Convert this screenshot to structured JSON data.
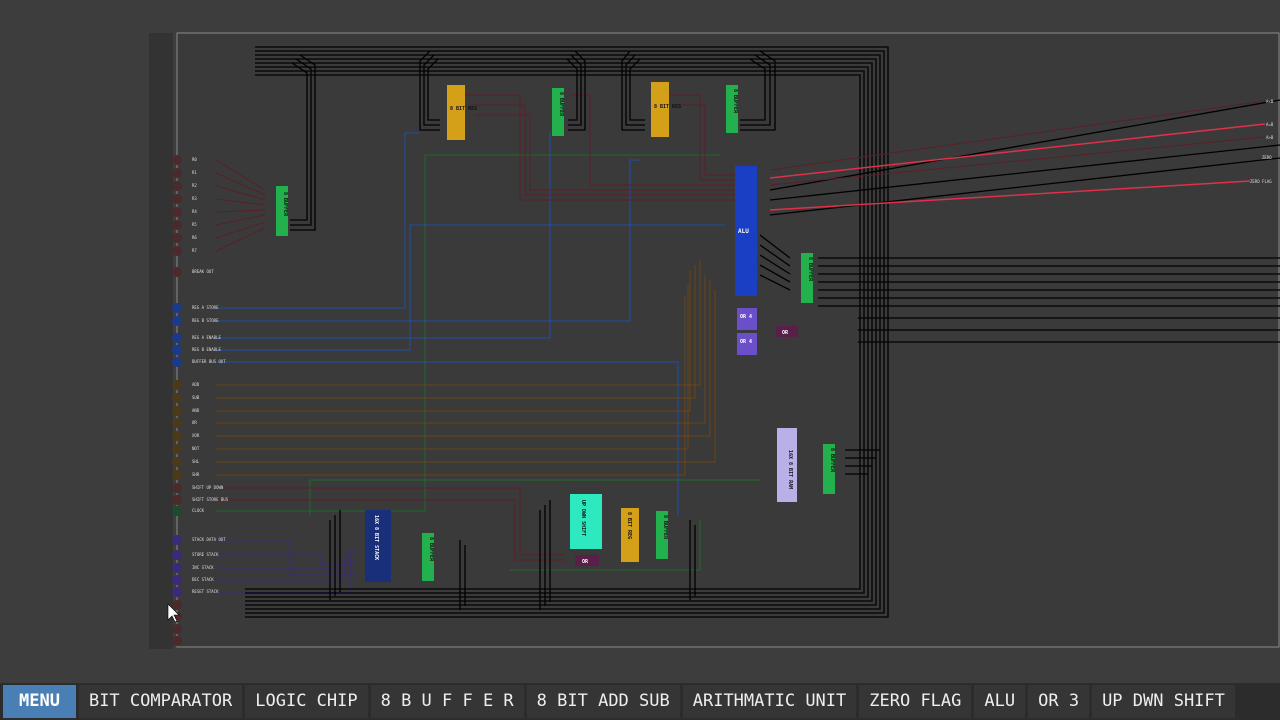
{
  "menu": {
    "label": "MENU"
  },
  "toolbar": {
    "items": [
      "BIT COMPARATOR",
      "LOGIC CHIP",
      "8 B U F F E R",
      "8 BIT ADD SUB",
      "ARITHMATIC UNIT",
      "ZERO FLAG",
      "ALU",
      "OR 3",
      "UP DWN SHIFT"
    ]
  },
  "colors": {
    "background": "#3d3d3d",
    "board": "#3a3a3a",
    "wire": "#000000",
    "register_chip": "#d4a017",
    "buffer_chip": "#22b14c",
    "alu_chip": "#1a3fc4",
    "or_chip": "#6b4fc9",
    "stack_chip": "#1a2f7a",
    "shift_chip": "#2ee8c0",
    "ram_chip": "#b9b0e8",
    "menu_accent": "#4a7fb5"
  },
  "chips": {
    "reg_a": "8 BIT REG",
    "buf_a": "8 BUFFER",
    "reg_b": "8 BIT REG",
    "buf_b": "8 BUFFER",
    "buf_in": "8 BUFFER",
    "alu": "ALU",
    "buf_alu": "8 BUFFER",
    "or4_a": "OR 4",
    "or4_b": "OR 4",
    "or_flag": "OR",
    "ram": "16X 8 BIT RAM",
    "buf_ram": "8 BUFFER",
    "stack": "16X 8 BIT STACK",
    "buf_stack": "8 BUFFER",
    "shift": "UP DWN SHIFT",
    "reg_c": "8 BIT REG",
    "buf_c": "8 BUFFER",
    "or_shift": "OR"
  },
  "pins": {
    "alu_outputs": [
      "A<B",
      "A=B",
      "A>B",
      "ZERO",
      "ZERO FLAG"
    ],
    "input_group_a": [
      "R0",
      "R1",
      "R2",
      "R3",
      "R4",
      "R5",
      "R6",
      "R7",
      "BREAK OUT"
    ],
    "input_group_b": [
      "REG A STORE",
      "REG B STORE",
      "REG A ENABLE",
      "REG B ENABLE",
      "BUFFER BUS OUT"
    ],
    "input_group_c": [
      "ADD",
      "SUB",
      "AND",
      "OR",
      "XOR",
      "NOT",
      "SHL",
      "SHR",
      "SHIFT UP DOWN",
      "SHIFT STORE BUS"
    ],
    "clock": "CLOCK",
    "input_group_d": [
      "STACK DATA OUT",
      "STORE STACK",
      "INC STACK",
      "DEC STACK",
      "RESET STACK"
    ]
  }
}
